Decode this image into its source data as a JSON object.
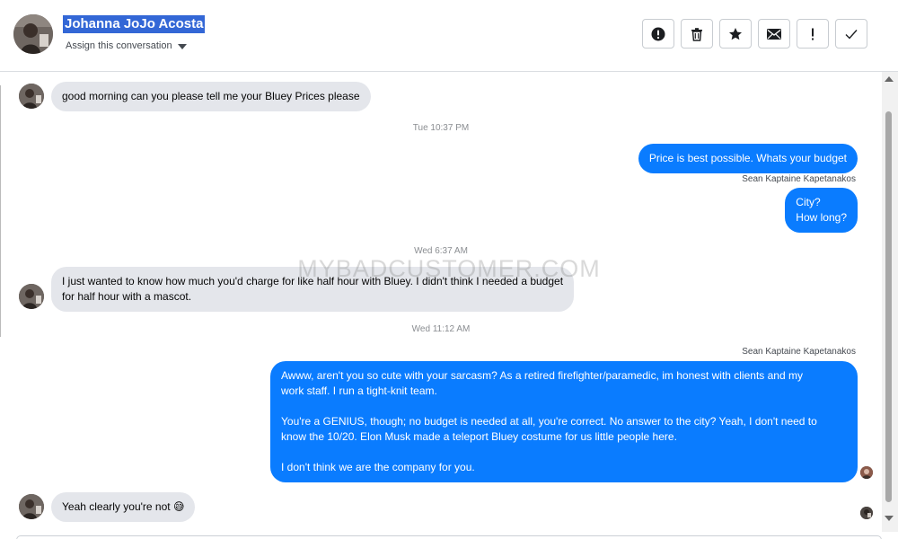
{
  "header": {
    "contact_name": "Johanna JoJo Acosta",
    "assign_label": "Assign this conversation",
    "actions": [
      {
        "name": "report-icon",
        "label": "Report"
      },
      {
        "name": "trash-icon",
        "label": "Delete"
      },
      {
        "name": "star-icon",
        "label": "Star"
      },
      {
        "name": "mail-icon",
        "label": "Mark as unread"
      },
      {
        "name": "exclamation-icon",
        "label": "Follow up"
      },
      {
        "name": "checkmark-icon",
        "label": "Mark as done"
      }
    ]
  },
  "conversation": {
    "watermark": "MYBADCUSTOMER.COM",
    "messages": [
      {
        "from": "customer",
        "text": "good morning can you please tell me your Bluey Prices please"
      },
      {
        "timestamp": "Tue 10:37 PM"
      },
      {
        "from": "page",
        "text": "Price is best possible. Whats your budget",
        "sender": "Sean Kaptaine Kapetanakos"
      },
      {
        "from": "page",
        "lines": [
          "City?",
          "How long?"
        ]
      },
      {
        "timestamp": "Wed 6:37 AM"
      },
      {
        "from": "customer",
        "lines": [
          "I just wanted to know how much you'd charge for like half hour with Bluey. I didn't think I needed a budget",
          "for half hour with a mascot."
        ]
      },
      {
        "timestamp": "Wed 11:12 AM"
      },
      {
        "from": "page",
        "sender": "Sean Kaptaine Kapetanakos",
        "paragraphs": [
          [
            "Awww, aren't you so cute with your sarcasm? As a retired firefighter/paramedic, im honest with clients and my",
            "work staff. I run a tight-knit team."
          ],
          [
            "You're a GENIUS, though; no budget is needed at all, you're correct.  No answer to the city? Yeah, I don't need to",
            "know the 10/20. Elon Musk made a teleport Bluey costume for us little people here."
          ],
          [
            "I don't think we are the company for you."
          ]
        ]
      },
      {
        "from": "customer",
        "text": "Yeah clearly you're not",
        "emoji": "😅"
      }
    ]
  },
  "colors": {
    "outgoing_bubble": "#0a7cff",
    "incoming_bubble": "#e4e6eb",
    "name_highlight": "#3367d6"
  }
}
